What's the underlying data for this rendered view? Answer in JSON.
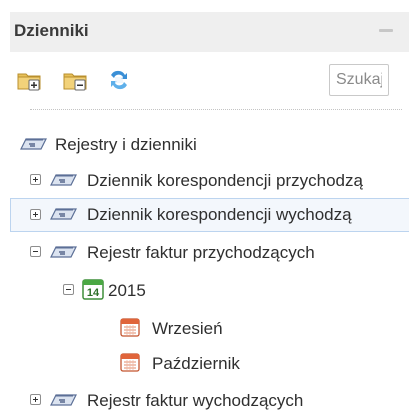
{
  "panel": {
    "title": "Dzienniki"
  },
  "toolbar": {
    "add_folder_icon": "folder-add-icon",
    "remove_folder_icon": "folder-remove-icon",
    "refresh_icon": "refresh-icon",
    "search_placeholder": "Szukaj"
  },
  "colors": {
    "header_bg": "#efefef",
    "selected_bg": "#f3f7fc",
    "selected_border": "#bcd4ef",
    "folder_yellow": "#e8c15a",
    "refresh_blue": "#3a8fd6"
  },
  "tree": {
    "root": {
      "label": "Rejestry i dzienniki",
      "icon": "book-registry-icon"
    },
    "items": [
      {
        "label": "Dziennik korespondencji przychodzą",
        "icon": "book-registry-icon",
        "state": "collapsed",
        "selected": false
      },
      {
        "label": "Dziennik korespondencji wychodzą",
        "icon": "book-registry-icon",
        "state": "collapsed",
        "selected": true
      },
      {
        "label": "Rejestr faktur przychodzących",
        "icon": "book-registry-icon",
        "state": "expanded",
        "selected": false
      },
      {
        "label": "2015",
        "icon": "calendar-year-icon",
        "icon_text": "14",
        "state": "expanded",
        "selected": false
      },
      {
        "label": "Wrzesień",
        "icon": "calendar-month-icon",
        "selected": false
      },
      {
        "label": "Październik",
        "icon": "calendar-month-icon",
        "selected": false
      },
      {
        "label": "Rejestr faktur wychodzących",
        "icon": "book-registry-icon",
        "state": "collapsed",
        "selected": false
      }
    ]
  }
}
